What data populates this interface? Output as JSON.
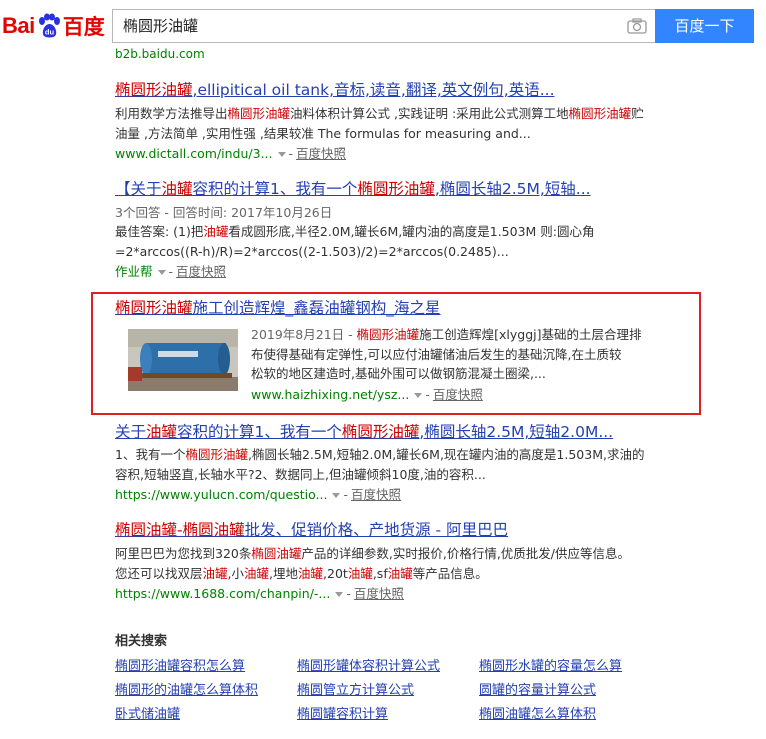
{
  "header": {
    "logo_latin": "Bai",
    "logo_chinese": "百度",
    "search_query": "椭圆形油罐",
    "search_button": "百度一下"
  },
  "truncated_url": "b2b.baidu.com",
  "results": {
    "r1": {
      "title_em": "椭圆形油罐",
      "title_rest": ",ellipitical oil tank,音标,读音,翻译,英文例句,英语...",
      "abs_a": "利用数学方法推导出",
      "abs_em1": "椭圆形油罐",
      "abs_b": "油料体积计算公式 ,实践证明 :采用此公式测算工地",
      "abs_em2": "椭圆形油罐",
      "abs_c": "贮油量 ,方法简单 ,实用性强 ,结果较准 The formulas for measuring and...",
      "url": "www.dictall.com/indu/3...",
      "snapshot": "百度快照"
    },
    "r2": {
      "title_a": "【关于",
      "title_em1": "油罐",
      "title_b": "容积的计算1、我有一个",
      "title_em2": "椭圆形油罐",
      "title_c": ",椭圆长轴2.5M,短轴...",
      "meta": "3个回答 - 回答时间: 2017年10月26日",
      "abs_a": "最佳答案: (1)把",
      "abs_em": "油罐",
      "abs_b": "看成圆形底,半径2.0M,罐长6M,罐内油的高度是1.503M 则:圆心角",
      "abs_line2": "=2*arccos((R-h)/R)=2*arccos((2-1.503)/2)=2*arccos(0.2485)...",
      "source": "作业帮",
      "snapshot": "百度快照"
    },
    "r3": {
      "title_em": "椭圆形油罐",
      "title_rest": "施工创造辉煌_鑫磊油罐钢构_海之星",
      "date": "2019年8月21日 - ",
      "abs_em": "椭圆形油罐",
      "abs_a": "施工创造辉煌[xlyggj]基础的土层合理排",
      "abs_line2": "布使得基础有定弹性,可以应付油罐储油后发生的基础沉降,在土质较",
      "abs_line3": "松软的地区建造时,基础外围可以做钢筋混凝土圈梁,...",
      "url": "www.haizhixing.net/ysz...",
      "snapshot": "百度快照"
    },
    "r4": {
      "title_a": "关于",
      "title_em1": "油罐",
      "title_b": "容积的计算1、我有一个",
      "title_em2": "椭圆形油罐",
      "title_c": ",椭圆长轴2.5M,短轴2.0M...",
      "abs_a": "1、我有一个",
      "abs_em": "椭圆形油罐",
      "abs_b": ",椭圆长轴2.5M,短轴2.0M,罐长6M,现在罐内油的高度是1.503M,求油的",
      "abs_line2": "容积,短轴竖直,长轴水平?2、数据同上,但油罐倾斜10度,油的容积...",
      "url": "https://www.yulucn.com/questio...",
      "snapshot": "百度快照"
    },
    "r5": {
      "title_em1": "椭圆油罐",
      "title_a": "-",
      "title_em2": "椭圆油罐",
      "title_b": "批发、促销价格、产地货源 - 阿里巴巴",
      "abs_a": "阿里巴巴为您找到320条",
      "abs_em1": "椭圆油罐",
      "abs_b": "产品的详细参数,实时报价,价格行情,优质批发/供应等信息。",
      "abs_c": "您还可以找双层",
      "abs_em2": "油罐",
      "abs_d": ",小",
      "abs_em3": "油罐",
      "abs_e": ",埋地",
      "abs_em4": "油罐",
      "abs_f": ",20t",
      "abs_em5": "油罐",
      "abs_g": ",sf",
      "abs_em6": "油罐",
      "abs_h": "等产品信息。",
      "url": "https://www.1688.com/chanpin/-...",
      "snapshot": "百度快照"
    }
  },
  "related": {
    "title": "相关搜索",
    "items": [
      "椭圆形油罐容积怎么算",
      "椭圆形罐体容积计算公式",
      "椭圆形水罐的容量怎么算",
      "椭圆形的油罐怎么算体积",
      "椭圆管立方计算公式",
      "圆罐的容量计算公式",
      "卧式储油罐",
      "椭圆罐容积计算",
      "椭圆油罐怎么算体积"
    ]
  },
  "colors": {
    "link": "#2440b3",
    "highlight_red": "#c00",
    "url_green": "#008000",
    "button_blue": "#3385ff",
    "annotation_box": "#e02020"
  }
}
